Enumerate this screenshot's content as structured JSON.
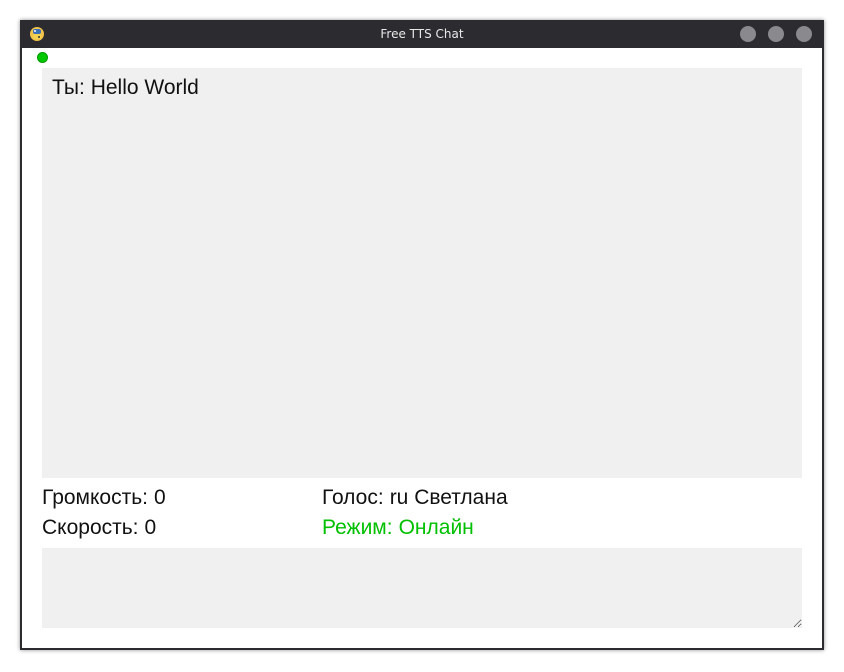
{
  "window": {
    "title": "Free TTS Chat",
    "app_icon": "python-snake-icon"
  },
  "status": {
    "indicator": "online-dot",
    "color": "#00c800"
  },
  "chat": {
    "messages": [
      {
        "speaker": "Ты:",
        "text": "Hello World"
      }
    ]
  },
  "settings": {
    "volume_label": "Громкость:",
    "volume_value": "0",
    "speed_label": "Скорость:",
    "speed_value": "0",
    "voice_label": "Голос:",
    "voice_value": "ru Светлана",
    "mode_label": "Режим:",
    "mode_value": "Онлайн",
    "mode_color": "#00c000"
  },
  "input": {
    "value": ""
  },
  "colors": {
    "titlebar": "#2b2b30",
    "panel_bg": "#f0f0f0",
    "text": "#111111"
  }
}
